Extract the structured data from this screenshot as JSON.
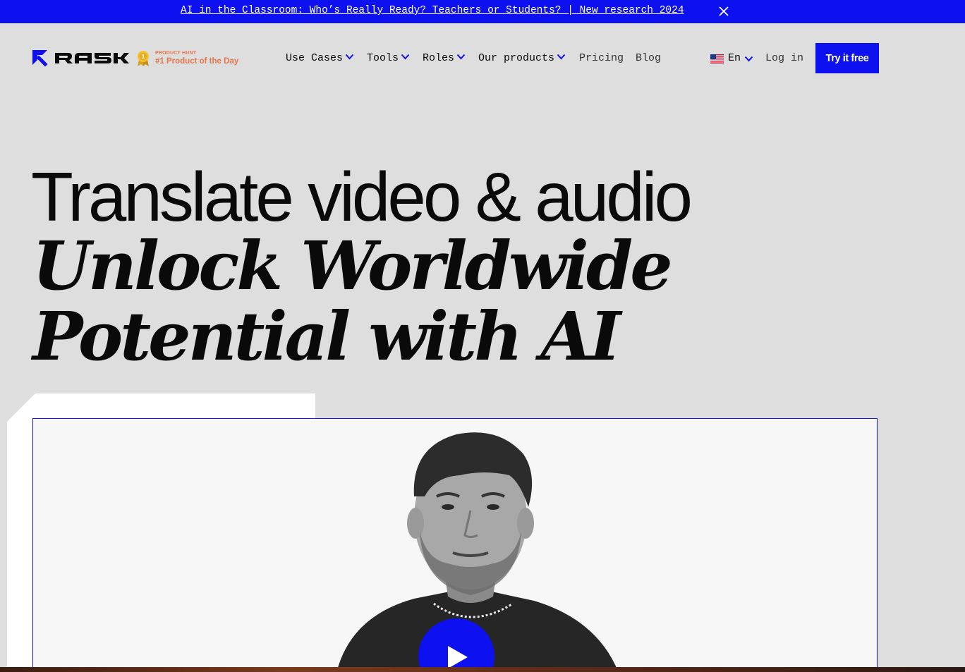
{
  "announcement": {
    "text": "AI in the Classroom: Who’s Really Ready? Teachers or Students? | New research 2024",
    "close_icon": "close-icon"
  },
  "header": {
    "logo_text": "RASK",
    "badge": {
      "small": "PRODUCT HUNT",
      "big": "#1 Product of the Day",
      "icon": "medal-icon"
    },
    "nav": [
      {
        "label": "Use Cases",
        "dropdown": true
      },
      {
        "label": "Tools",
        "dropdown": true
      },
      {
        "label": "Roles",
        "dropdown": true
      },
      {
        "label": "Our products",
        "dropdown": true
      },
      {
        "label": "Pricing",
        "dropdown": false
      },
      {
        "label": "Blog",
        "dropdown": false
      }
    ],
    "language": {
      "label": "En",
      "flag_icon": "us-flag-icon"
    },
    "login_label": "Log in",
    "cta_label": "Try it free"
  },
  "hero": {
    "line1": "Translate video & audio",
    "line2": "Unlock Worldwide",
    "line3": "Potential with AI"
  },
  "video": {
    "play_icon": "play-icon"
  },
  "colors": {
    "accent": "#0d10ef",
    "background": "#dedede",
    "badge": "#e8744a"
  }
}
